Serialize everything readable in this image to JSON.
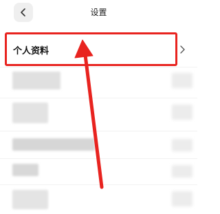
{
  "header": {
    "title": "设置",
    "back_icon": "chevron-left-icon"
  },
  "list": {
    "items": [
      {
        "label": "个人资料",
        "icon": "chevron-right-icon"
      }
    ]
  },
  "annotation": {
    "color": "#e8231f"
  }
}
